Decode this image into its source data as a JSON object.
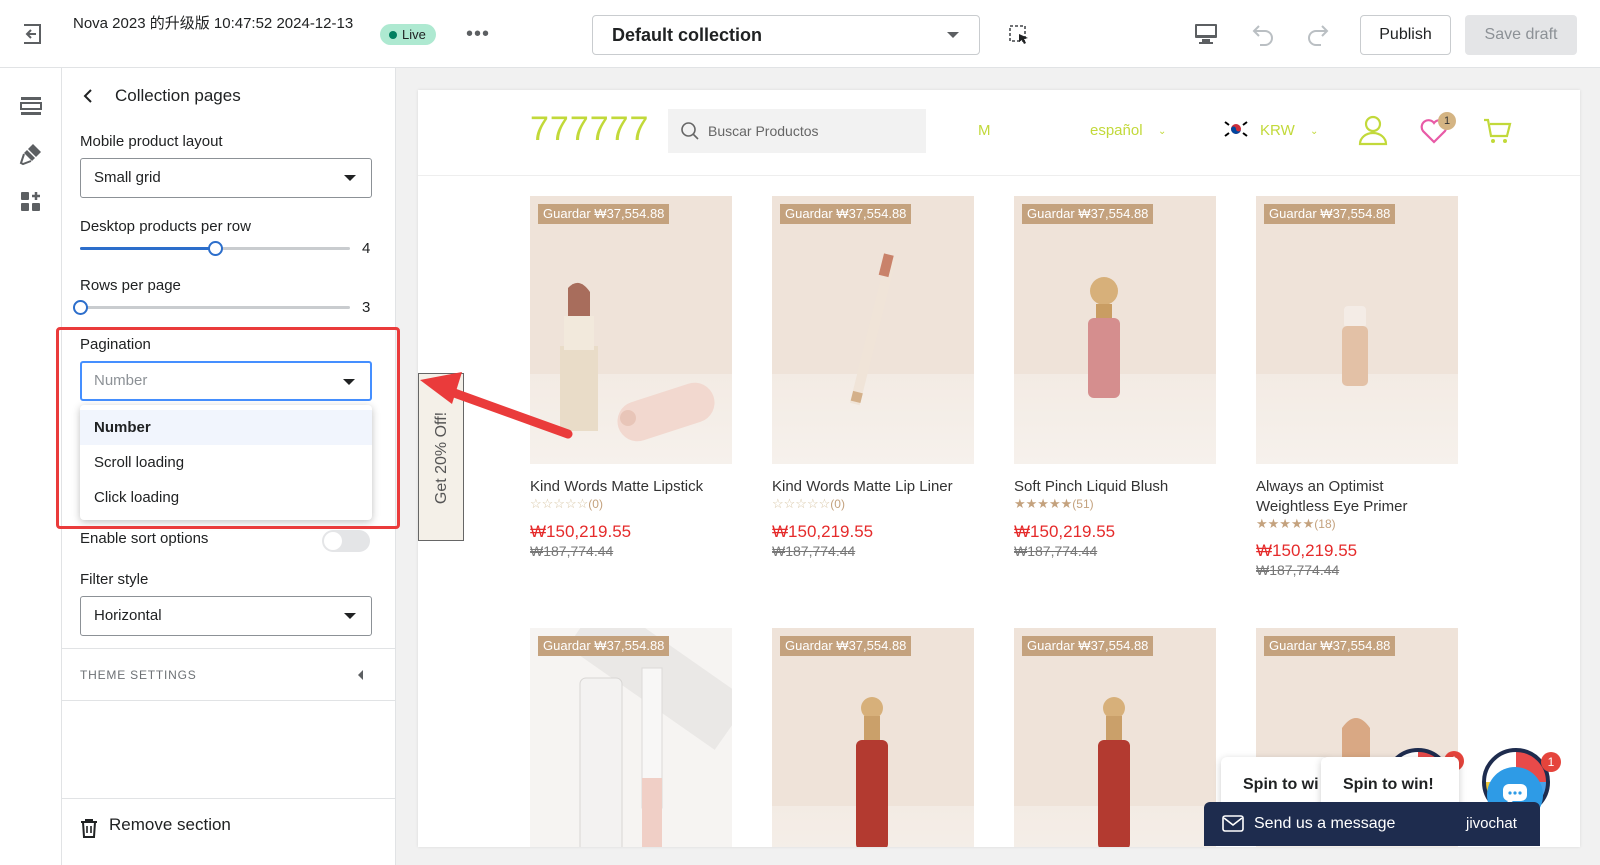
{
  "topbar": {
    "theme_name": "Nova 2023 的升级版 10:47:52 2024-12-13",
    "live_label": "Live",
    "more_label": "•••",
    "collection_select": "Default collection",
    "publish_label": "Publish",
    "save_draft_label": "Save draft"
  },
  "panel": {
    "title": "Collection pages",
    "mobile_layout_label": "Mobile product layout",
    "mobile_layout_value": "Small grid",
    "desktop_per_row_label": "Desktop products per row",
    "desktop_per_row_value": "4",
    "desktop_per_row_fraction": 0.5,
    "rows_per_page_label": "Rows per page",
    "rows_per_page_value": "3",
    "rows_per_page_fraction": 0.0,
    "pagination_label": "Pagination",
    "pagination_value": "Number",
    "pagination_options": [
      "Number",
      "Scroll loading",
      "Click loading"
    ],
    "sort_label": "Enable sort options",
    "sort_enabled": false,
    "filter_style_label": "Filter style",
    "filter_style_value": "Horizontal",
    "theme_settings_label": "THEME SETTINGS",
    "remove_section_label": "Remove section"
  },
  "store": {
    "logo": "777777",
    "search_placeholder": "Buscar Productos",
    "nav_partial": "M",
    "language": "español",
    "currency": "KRW",
    "wishlist_count": "1",
    "side_tab": "Get 20% Off!",
    "products": [
      {
        "save": "Guardar ₩37,554.88",
        "title": "Kind Words Matte Lipstick",
        "stars": "☆☆☆☆☆",
        "count": "(0)",
        "price": "₩150,219.55",
        "compare": "₩187,774.44"
      },
      {
        "save": "Guardar ₩37,554.88",
        "title": "Kind Words Matte Lip Liner",
        "stars": "☆☆☆☆☆",
        "count": "(0)",
        "price": "₩150,219.55",
        "compare": "₩187,774.44"
      },
      {
        "save": "Guardar ₩37,554.88",
        "title": "Soft Pinch Liquid Blush",
        "stars": "★★★★★",
        "count": "(51)",
        "price": "₩150,219.55",
        "compare": "₩187,774.44"
      },
      {
        "save": "Guardar ₩37,554.88",
        "title": "Always an Optimist Weightless Eye Primer",
        "stars": "★★★★★",
        "count": "(18)",
        "price": "₩150,219.55",
        "compare": "₩187,774.44"
      },
      {
        "save": "Guardar ₩37,554.88"
      },
      {
        "save": "Guardar ₩37,554.88"
      },
      {
        "save": "Guardar ₩37,554.88"
      },
      {
        "save": "Guardar ₩37,554.88"
      }
    ]
  },
  "widgets": {
    "spin_partial": "Spin to wi",
    "spin": "Spin to win!",
    "spin_badge": "1",
    "chat_badge": "1",
    "chat_message": "Send us a message",
    "chat_brand": "jivochat"
  },
  "colors": {
    "accent_blue": "#2c6ecb",
    "highlight_red": "#ea3b3b",
    "store_green": "#c2d93a",
    "price_red": "#e52b2b",
    "badge_tan": "#c4a27e",
    "live_green": "#aee9d1"
  }
}
